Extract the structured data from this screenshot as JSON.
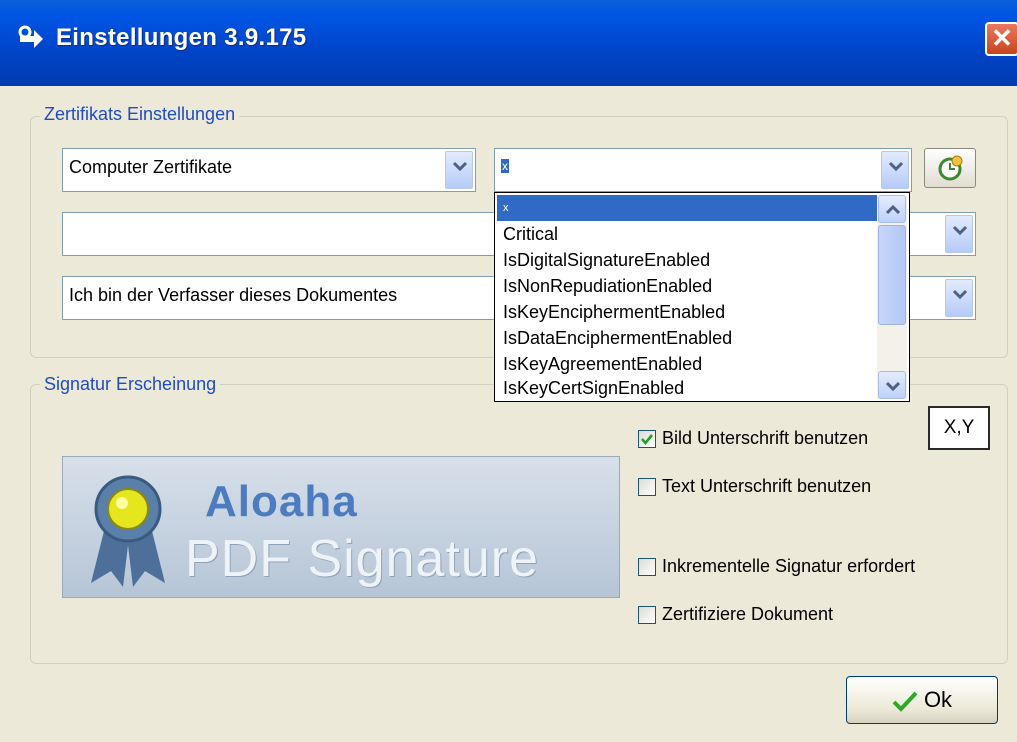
{
  "window": {
    "title": "Einstellungen 3.9.175",
    "close_label": "✕"
  },
  "certificate_group": {
    "label": "Zertifikats Einstellungen",
    "store_combo_value": "Computer Zertifikate",
    "filter_combo_value": "x",
    "reason_combo_value": "",
    "role_combo_value": "Ich bin der Verfasser dieses Dokumentes",
    "dropdown_items": [
      "x",
      "Critical",
      "IsDigitalSignatureEnabled",
      "IsNonRepudiationEnabled",
      "IsKeyEnciphermentEnabled",
      "IsDataEnciphermentEnabled",
      "IsKeyAgreementEnabled",
      "IsKeyCertSignEnabled"
    ]
  },
  "signature_group": {
    "label": "Signatur Erscheinung",
    "logo_line1": "Aloaha",
    "logo_line2": "PDF Signature",
    "options": [
      {
        "label": "Bild Unterschrift benutzen",
        "checked": true
      },
      {
        "label": "Text Unterschrift benutzen",
        "checked": false
      },
      {
        "label": "Inkrementelle Signatur erfordert",
        "checked": false
      },
      {
        "label": "Zertifiziere Dokument",
        "checked": false
      }
    ],
    "xy_button_label": "X,Y"
  },
  "ok_button_label": "Ok",
  "colors": {
    "title_blue": "#0055e5",
    "selection": "#316ac5",
    "group_label": "#1f4dbd"
  }
}
